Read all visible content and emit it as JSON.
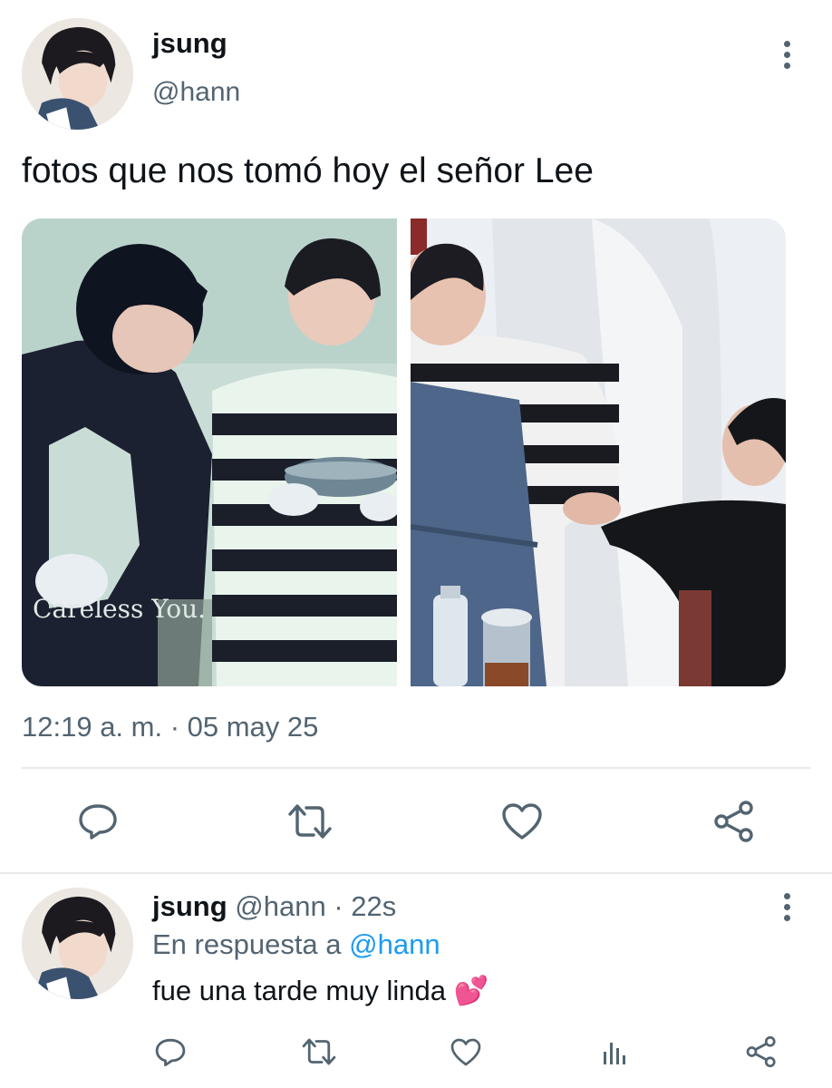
{
  "tweet": {
    "display_name": "jsung",
    "handle": "@hann",
    "text": "fotos que nos tomó hoy el señor Lee",
    "photo_captions": {
      "left_shirt_print": "Careless You."
    },
    "timestamp": "12:19 a. m. · 05 may 25",
    "actions": [
      "reply-icon",
      "retweet-icon",
      "like-icon",
      "share-icon"
    ]
  },
  "reply": {
    "display_name": "jsung",
    "handle_time": "@hann · 22s",
    "in_reply_prefix": "En respuesta a",
    "in_reply_handle": "@hann",
    "text": "fue una tarde muy linda",
    "emoji": "💕",
    "actions": [
      "reply-icon",
      "retweet-icon",
      "like-icon",
      "analytics-icon",
      "share-icon"
    ]
  },
  "colors": {
    "text": "#0f1419",
    "muted": "#536471",
    "link": "#1d9bf0",
    "divider": "#e7e9ea"
  }
}
